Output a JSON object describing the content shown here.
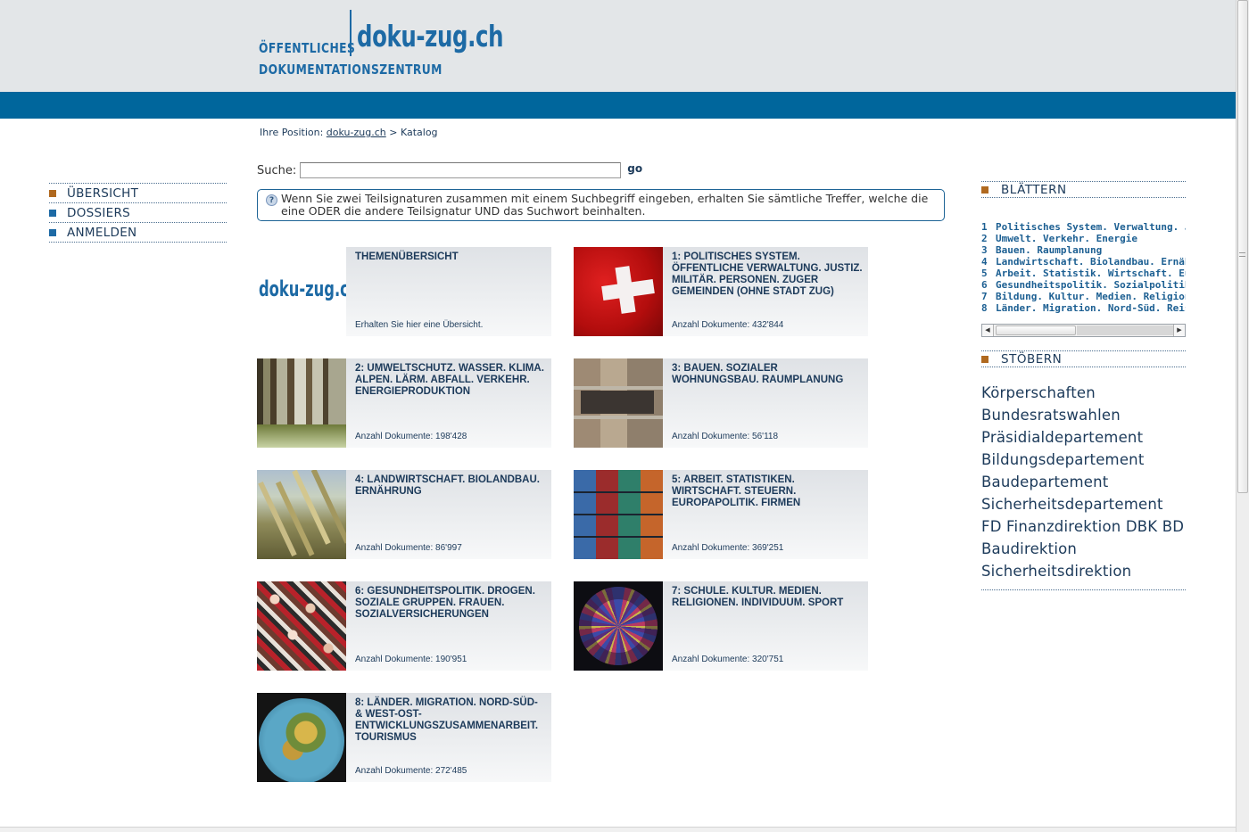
{
  "logo": {
    "line1": "ÖFFENTLICHES",
    "line2": "DOKUMENTATIONSZENTRUM",
    "brand": "doku-zug.ch"
  },
  "breadcrumb": {
    "prefix": "Ihre Position:",
    "link": "doku-zug.ch",
    "separator": ">",
    "current": "Katalog"
  },
  "search": {
    "label": "Suche:",
    "value": "",
    "button": "go"
  },
  "info": {
    "icon": "question-icon",
    "text": "Wenn Sie zwei Teilsignaturen zusammen mit einem Suchbegriff eingeben, erhalten Sie sämtliche Treffer, welche die eine ODER die andere Teilsignatur UND das Suchwort beinhalten."
  },
  "leftnav": {
    "items": [
      {
        "label": "ÜBERSICHT",
        "color": "#b0691f"
      },
      {
        "label": "DOSSIERS",
        "color": "#1d6aa5"
      },
      {
        "label": "ANMELDEN",
        "color": "#1d6aa5"
      }
    ]
  },
  "tiles": [
    {
      "image": "doku-zug.ch",
      "title": "THEMENÜBERSICHT",
      "count": "Erhalten Sie hier eine Übersicht."
    },
    {
      "image": "swiss-flag",
      "title": "1: POLITISCHES SYSTEM. ÖFFENTLICHE VERWALTUNG. JUSTIZ. MILITÄR. PERSONEN. ZUGER GEMEINDEN (OHNE STADT ZUG)",
      "count": "Anzahl Dokumente: 432'844"
    },
    {
      "image": "forest",
      "title": "2: UMWELTSCHUTZ. WASSER. KLIMA. ALPEN. LÄRM. ABFALL. VERKEHR. ENERGIEPRODUKTION",
      "count": "Anzahl Dokumente: 198'428"
    },
    {
      "image": "brick-wall",
      "title": "3: BAUEN. SOZIALER WOHNUNGSBAU. RAUMPLANUNG",
      "count": "Anzahl Dokumente: 56'118"
    },
    {
      "image": "wheat",
      "title": "4: LANDWIRTSCHAFT. BIOLANDBAU. ERNÄHRUNG",
      "count": "Anzahl Dokumente: 86'997"
    },
    {
      "image": "containers",
      "title": "5: ARBEIT. STATISTIKEN. WIRTSCHAFT. STEUERN. EUROPAPOLITIK. FIRMEN",
      "count": "Anzahl Dokumente: 369'251"
    },
    {
      "image": "crowd",
      "title": "6: GESUNDHEITSPOLITIK. DROGEN. SOZIALE GRUPPEN. FRAUEN. SOZIALVERSICHERUNGEN",
      "count": "Anzahl Dokumente: 190'951"
    },
    {
      "image": "rose-window",
      "title": "7: SCHULE. KULTUR. MEDIEN. RELIGIONEN. INDIVIDUUM. SPORT",
      "count": "Anzahl Dokumente: 320'751"
    },
    {
      "image": "globe",
      "title": "8: LÄNDER. MIGRATION. NORD-SÜD- & WEST-OST-ENTWICKLUNGSZUSAMMENARBEIT. TOURISMUS",
      "count": "Anzahl Dokumente: 272'485"
    }
  ],
  "browse": {
    "heading": "BLÄTTERN",
    "items": [
      {
        "num": "1",
        "label": "Politisches System. Verwaltung. Justiz"
      },
      {
        "num": "2",
        "label": "Umwelt. Verkehr. Energie"
      },
      {
        "num": "3",
        "label": "Bauen. Raumplanung"
      },
      {
        "num": "4",
        "label": "Landwirtschaft. Biolandbau. Ernährung"
      },
      {
        "num": "5",
        "label": "Arbeit. Statistik. Wirtschaft. Europapolitik"
      },
      {
        "num": "6",
        "label": "Gesundheitspolitik. Sozialpolitik. Frauen"
      },
      {
        "num": "7",
        "label": "Bildung. Kultur. Medien. Religion. Sport"
      },
      {
        "num": "8",
        "label": "Länder. Migration. Nord-Süd. Reisen"
      }
    ]
  },
  "explore": {
    "heading": "STÖBERN",
    "links": [
      "Körperschaften",
      "Bundesratswahlen",
      "Präsidialdepartement",
      "Bildungsdepartement",
      "Baudepartement",
      "Sicherheitsdepartement",
      "FD Finanzdirektion DBK BD",
      "Baudirektion",
      "Sicherheitsdirektion"
    ]
  },
  "colors": {
    "header_bg": "#e3e6e8",
    "blue_bar": "#00669c",
    "brand_blue": "#1d6aa5",
    "text_dark": "#1c3a5a",
    "accent_orange": "#b0691f"
  }
}
